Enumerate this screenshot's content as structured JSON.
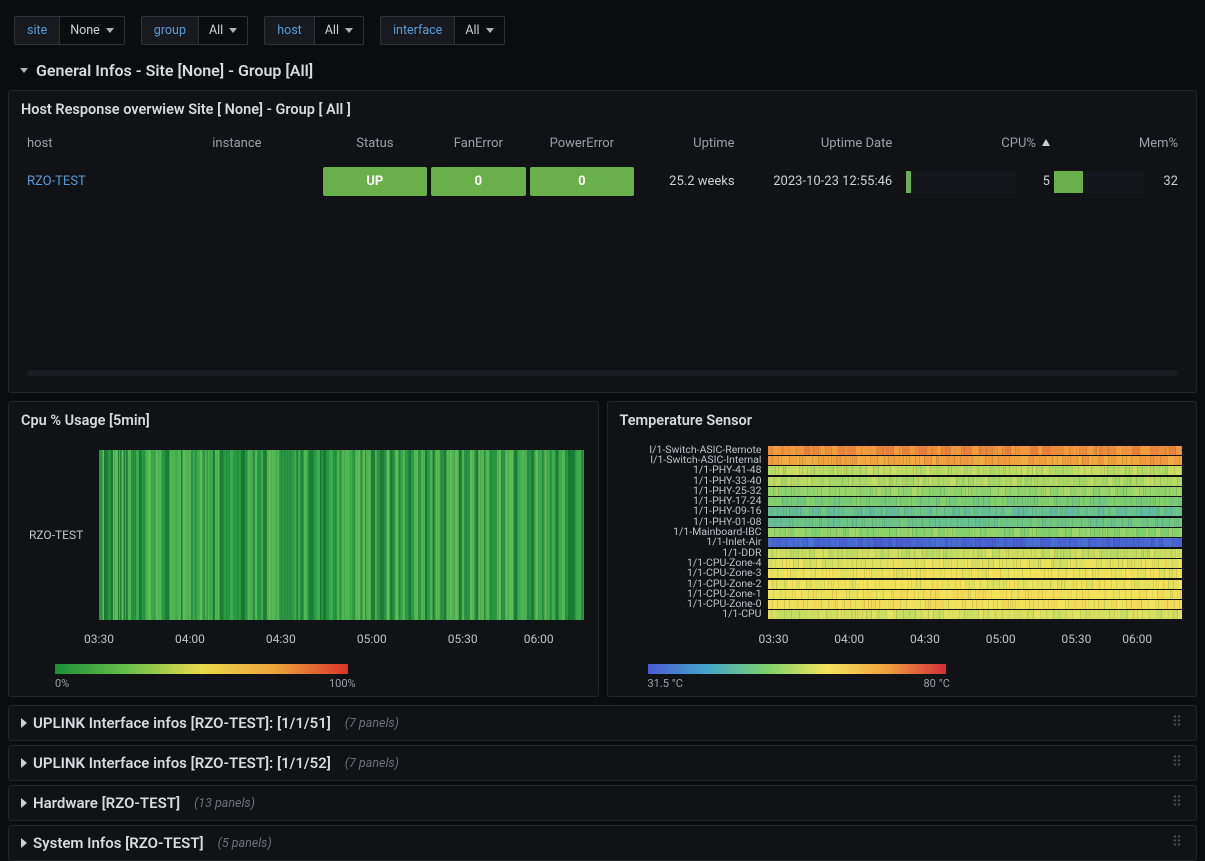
{
  "filters": {
    "site": {
      "label": "site",
      "value": "None"
    },
    "group": {
      "label": "group",
      "value": "All"
    },
    "host": {
      "label": "host",
      "value": "All"
    },
    "interface": {
      "label": "interface",
      "value": "All"
    }
  },
  "row_title": "General Infos - Site [None] - Group [All]",
  "host_panel": {
    "title": "Host Response overwiew Site [ None] - Group [ All ]",
    "columns": {
      "host": "host",
      "instance": "instance",
      "status": "Status",
      "fan": "FanError",
      "power": "PowerError",
      "uptime": "Uptime",
      "uptime_date": "Uptime Date",
      "cpu": "CPU%",
      "mem": "Mem%"
    },
    "rows": [
      {
        "host": "RZO-TEST",
        "status": "UP",
        "fan": "0",
        "power": "0",
        "uptime": "25.2 weeks",
        "uptime_date": "2023-10-23 12:55:46",
        "cpu": 5,
        "mem": 32
      }
    ]
  },
  "cpu_panel": {
    "title": "Cpu % Usage [5min]",
    "y_label": "RZO-TEST",
    "scale_min": "0%",
    "scale_max": "100%"
  },
  "temp_panel": {
    "title": "Temperature Sensor",
    "scale_min": "31.5 °C",
    "scale_max": "80 °C"
  },
  "x_ticks": [
    "03:30",
    "04:00",
    "04:30",
    "05:00",
    "05:30",
    "06:00"
  ],
  "collapsed_rows": [
    {
      "title": "UPLINK Interface infos [RZO-TEST]: [1/1/51]",
      "count": "(7 panels)"
    },
    {
      "title": "UPLINK Interface infos [RZO-TEST]: [1/1/52]",
      "count": "(7 panels)"
    },
    {
      "title": "Hardware [RZO-TEST]",
      "count": "(13 panels)"
    },
    {
      "title": "System Infos [RZO-TEST]",
      "count": "(5 panels)"
    }
  ],
  "chart_data": [
    {
      "type": "heatmap",
      "title": "Cpu % Usage [5min]",
      "x_range": [
        "03:00",
        "06:00"
      ],
      "x_ticks": [
        "03:30",
        "04:00",
        "04:30",
        "05:00",
        "05:30",
        "06:00"
      ],
      "categories": [
        "RZO-TEST"
      ],
      "value_range_pct": [
        0,
        100
      ],
      "approx_values_pct": {
        "RZO-TEST": 5
      },
      "color_scale": {
        "min": "0%",
        "max": "100%"
      }
    },
    {
      "type": "heatmap",
      "title": "Temperature Sensor",
      "x_range": [
        "03:00",
        "06:00"
      ],
      "x_ticks": [
        "03:30",
        "04:00",
        "04:30",
        "05:00",
        "05:30",
        "06:00"
      ],
      "categories": [
        "I/1-Switch-ASIC-Remote",
        "I/1-Switch-ASIC-Internal",
        "1/1-PHY-41-48",
        "1/1-PHY-33-40",
        "1/1-PHY-25-32",
        "1/1-PHY-17-24",
        "1/1-PHY-09-16",
        "1/1-PHY-01-08",
        "1/1-Mainboard-IBC",
        "1/1-Inlet-Air",
        "1/1-DDR",
        "1/1-CPU-Zone-4",
        "1/1-CPU-Zone-3",
        "1/1-CPU-Zone-2",
        "1/1-CPU-Zone-1",
        "1/1-CPU-Zone-0",
        "1/1-CPU"
      ],
      "approx_values_c": {
        "I/1-Switch-ASIC-Remote": 72,
        "I/1-Switch-ASIC-Internal": 70,
        "1/1-PHY-41-48": 56,
        "1/1-PHY-33-40": 55,
        "1/1-PHY-25-32": 53,
        "1/1-PHY-17-24": 50,
        "1/1-PHY-09-16": 47,
        "1/1-PHY-01-08": 48,
        "1/1-Mainboard-IBC": 52,
        "1/1-Inlet-Air": 33,
        "1/1-DDR": 57,
        "1/1-CPU-Zone-4": 59,
        "1/1-CPU-Zone-3": 60,
        "1/1-CPU-Zone-2": 60,
        "1/1-CPU-Zone-1": 61,
        "1/1-CPU-Zone-0": 61,
        "1/1-CPU": 58
      },
      "color_scale": {
        "min": "31.5 °C",
        "max": "80 °C"
      }
    }
  ]
}
